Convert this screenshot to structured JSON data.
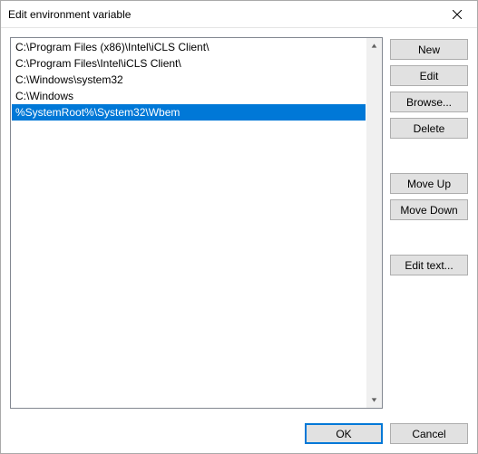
{
  "window": {
    "title": "Edit environment variable"
  },
  "list": {
    "items": [
      {
        "text": "C:\\Program Files (x86)\\Intel\\iCLS Client\\",
        "selected": false
      },
      {
        "text": "C:\\Program Files\\Intel\\iCLS Client\\",
        "selected": false
      },
      {
        "text": "C:\\Windows\\system32",
        "selected": false
      },
      {
        "text": "C:\\Windows",
        "selected": false
      },
      {
        "text": "%SystemRoot%\\System32\\Wbem",
        "selected": true
      }
    ]
  },
  "buttons": {
    "new": "New",
    "edit": "Edit",
    "browse": "Browse...",
    "delete": "Delete",
    "move_up": "Move Up",
    "move_down": "Move Down",
    "edit_text": "Edit text...",
    "ok": "OK",
    "cancel": "Cancel"
  }
}
